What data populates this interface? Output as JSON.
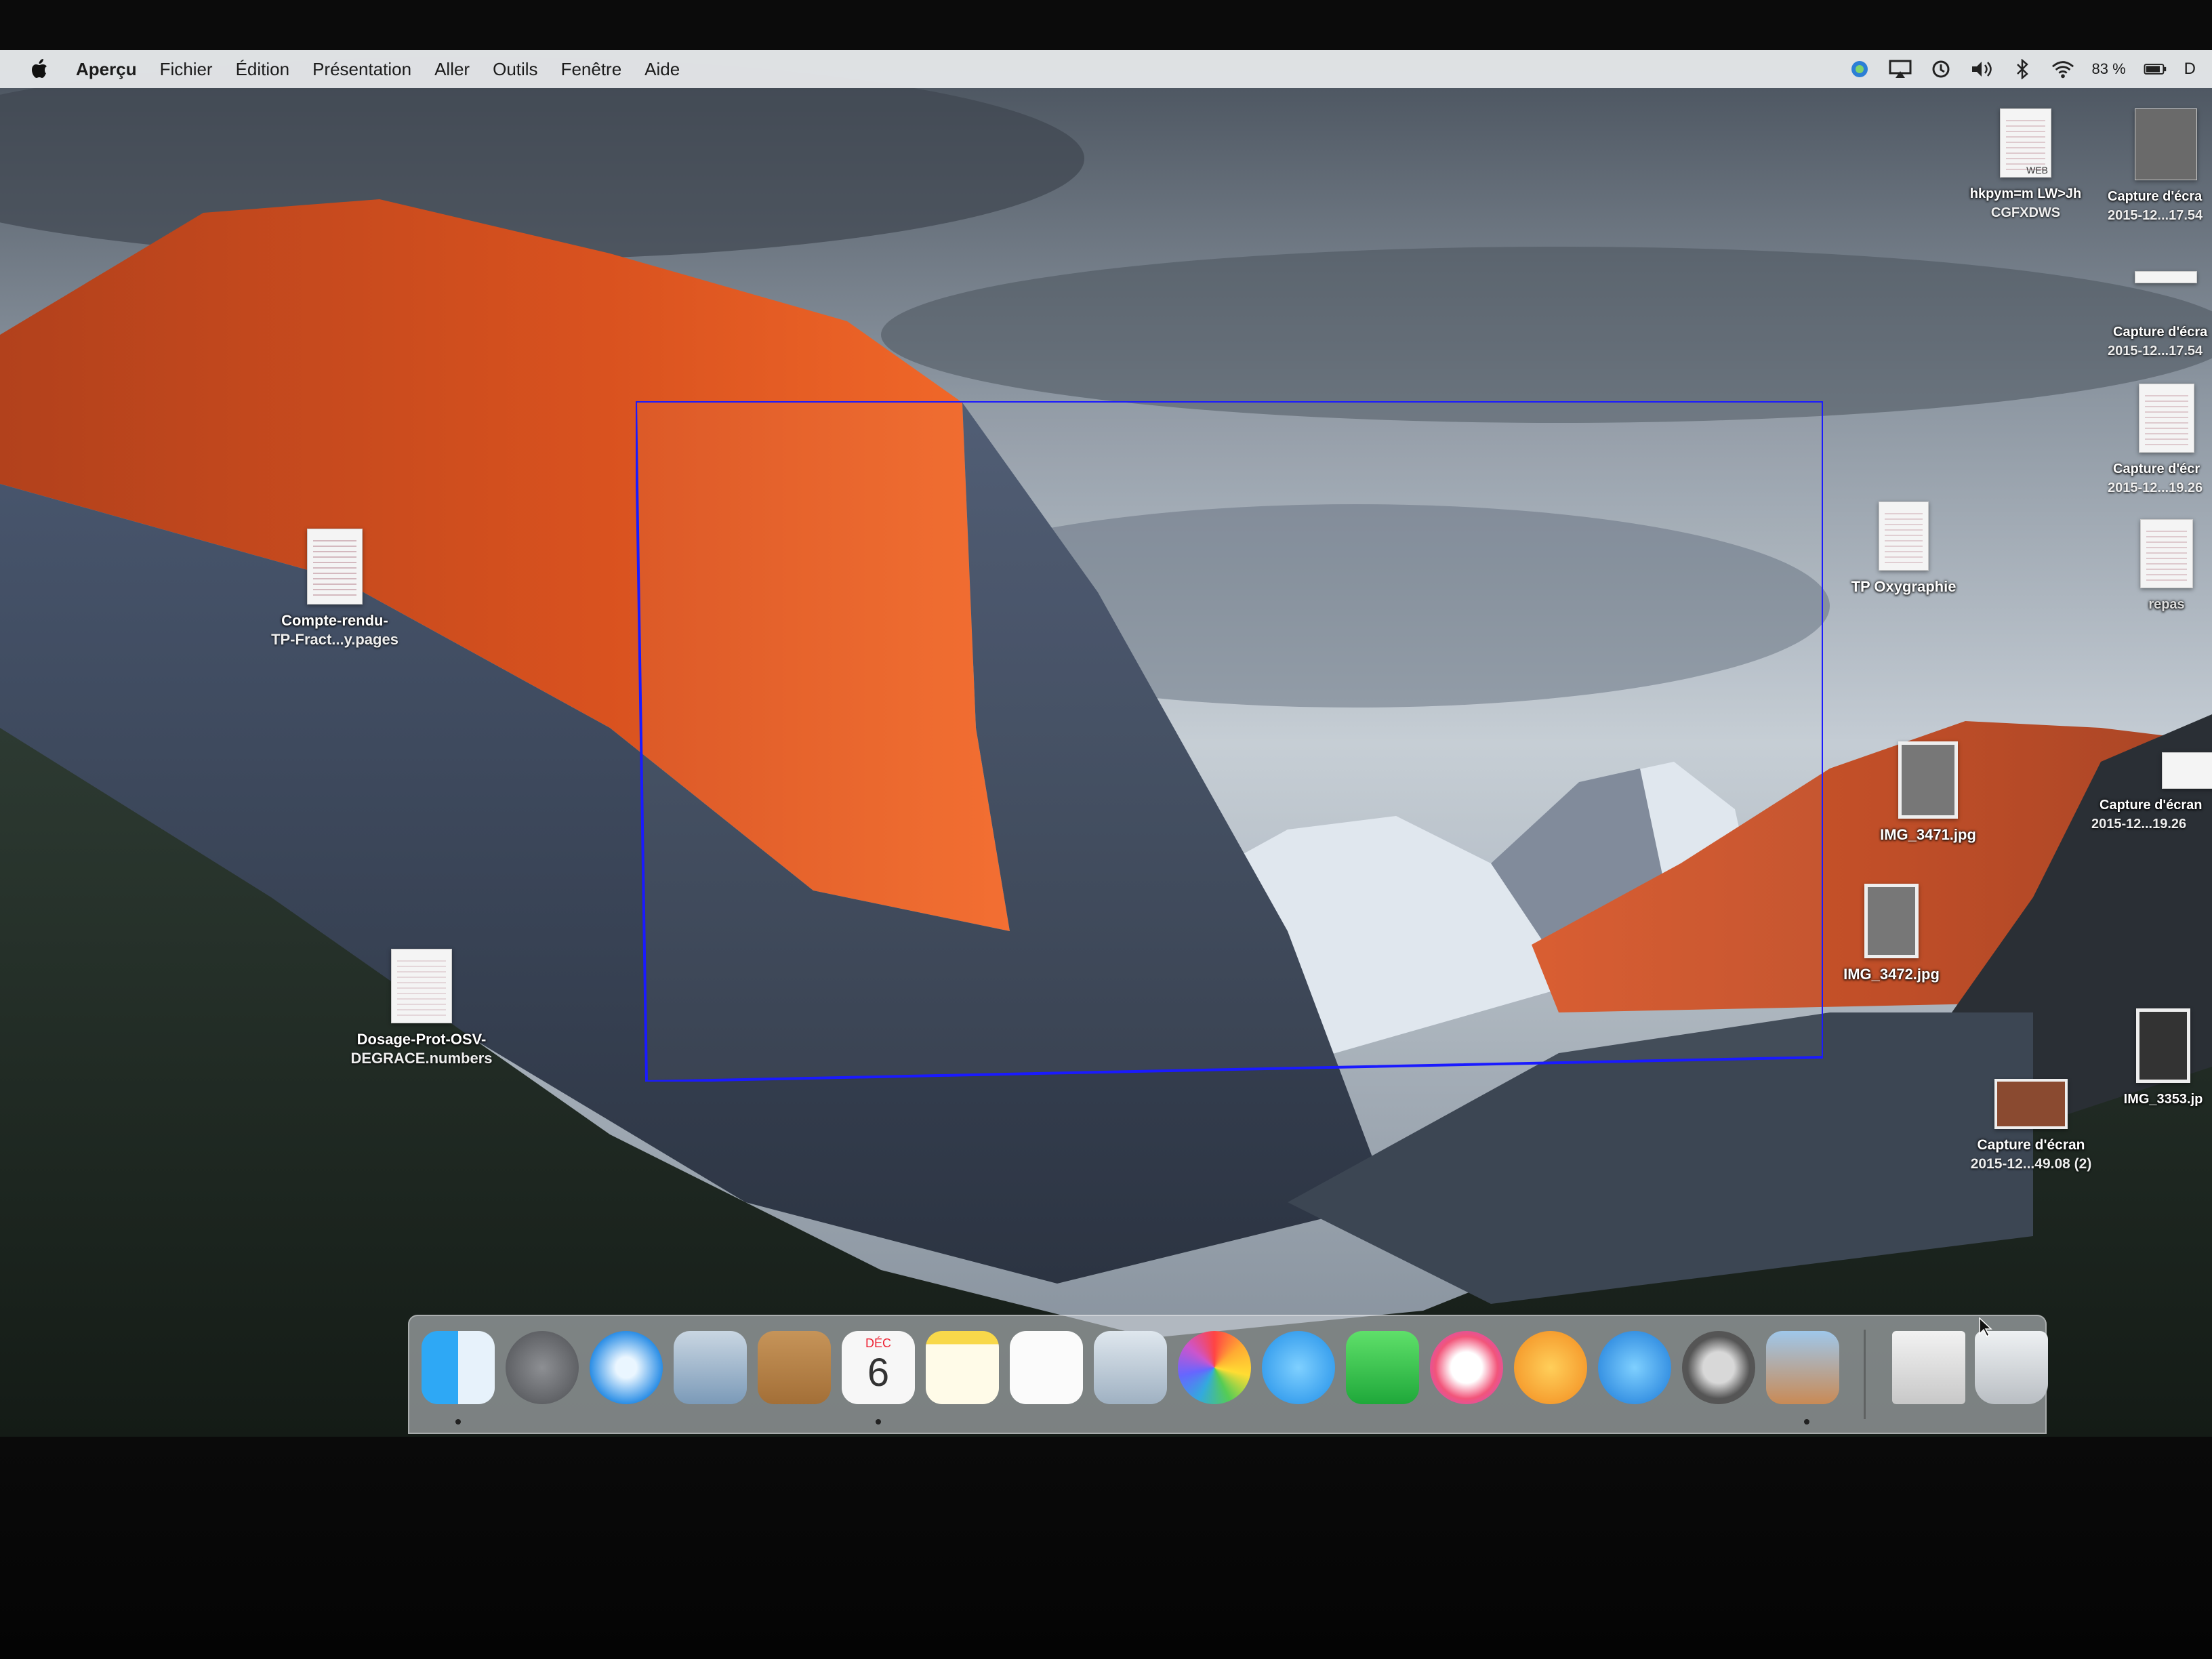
{
  "menubar": {
    "app_name": "Aperçu",
    "items": [
      "Fichier",
      "Édition",
      "Présentation",
      "Aller",
      "Outils",
      "Fenêtre",
      "Aide"
    ],
    "battery_percent": "83 %",
    "trailing_letter": "D",
    "status_icons": [
      "apple-logo-icon",
      "extension-icon",
      "airplay-icon",
      "time-machine-icon",
      "volume-icon",
      "bluetooth-icon",
      "wifi-icon",
      "battery-icon"
    ]
  },
  "desktop_icons": {
    "compte_rendu": {
      "line1": "Compte-rendu-",
      "line2": "TP-Fract...y.pages"
    },
    "dosage": {
      "line1": "Dosage-Prot-OSV-",
      "line2": "DEGRACE.numbers"
    },
    "hkpym": {
      "line1": "hkpym=m  LW>Jh",
      "line2": "CGFXDWS",
      "badge": "WEB"
    },
    "capture1": {
      "line1": "Capture d'écra",
      "line2": "2015-12...17.54"
    },
    "capture2": {
      "line1": "Capture d'écra",
      "line2": "2015-12...17.54"
    },
    "capture3": {
      "line1": "Capture d'écr",
      "line2": "2015-12...19.26"
    },
    "repas": {
      "line1": "repas"
    },
    "tp_oxygraphie": {
      "line1": "TP Oxygraphie"
    },
    "img_3471": {
      "line1": "IMG_3471.jpg"
    },
    "capture4": {
      "line1": "Capture d'écran",
      "line2": "2015-12...19.26"
    },
    "img_3472": {
      "line1": "IMG_3472.jpg"
    },
    "img_3353": {
      "line1": "IMG_3353.jp"
    },
    "capture5": {
      "line1": "Capture d'écran",
      "line2": "2015-12...49.08 (2)"
    }
  },
  "dock": {
    "apps": [
      "finder-icon",
      "launchpad-icon",
      "safari-icon",
      "mail-icon",
      "contacts-icon",
      "calendar-icon",
      "notes-icon",
      "reminders-icon",
      "preview-icon",
      "photos-icon",
      "messages-icon",
      "facetime-icon",
      "itunes-icon",
      "ibooks-icon",
      "app-store-icon",
      "system-preferences-icon",
      "preview-images-icon",
      "downloads-stack-icon",
      "trash-icon"
    ],
    "calendar_month": "DÉC",
    "calendar_day": "6"
  },
  "colors": {
    "selection_border": "#1a1aff",
    "menubar_bg": "#e8eaec"
  }
}
